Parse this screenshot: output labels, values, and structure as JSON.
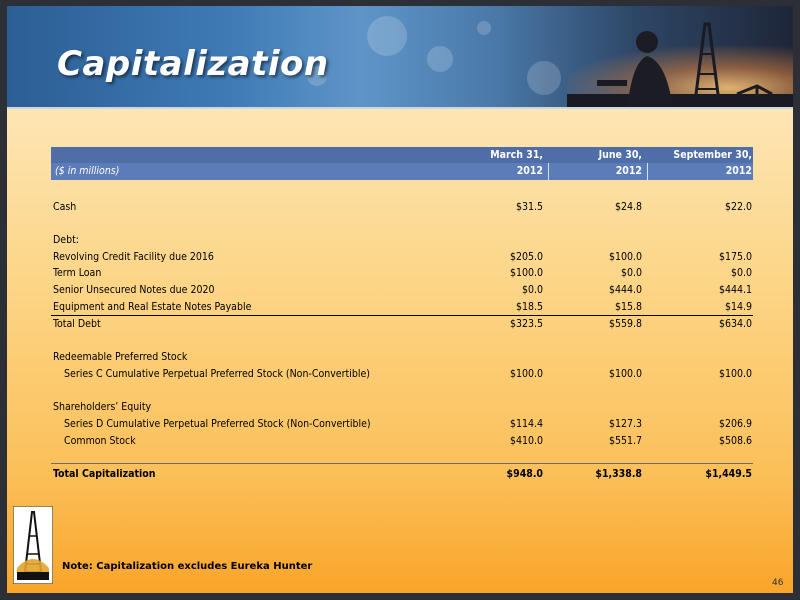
{
  "slide": {
    "title": "Capitalization",
    "note": "Note: Capitalization excludes Eureka Hunter",
    "page_number": "46"
  },
  "table": {
    "units_label": "($ in millions)",
    "columns": [
      {
        "line1": "March 31,",
        "line2": "2012"
      },
      {
        "line1": "June 30,",
        "line2": "2012"
      },
      {
        "line1": "September 30,",
        "line2": "2012"
      }
    ],
    "rows": [
      {
        "label": "Cash",
        "values": [
          "$31.5",
          "$24.8",
          "$22.0"
        ]
      },
      {
        "label": "Debt:",
        "values": [
          "",
          "",
          ""
        ]
      },
      {
        "label": "Revolving Credit Facility due 2016",
        "values": [
          "$205.0",
          "$100.0",
          "$175.0"
        ]
      },
      {
        "label": "Term Loan",
        "values": [
          "$100.0",
          "$0.0",
          "$0.0"
        ]
      },
      {
        "label": "Senior Unsecured Notes due 2020",
        "values": [
          "$0.0",
          "$444.0",
          "$444.1"
        ]
      },
      {
        "label": "Equipment and Real Estate Notes Payable",
        "values": [
          "$18.5",
          "$15.8",
          "$14.9"
        ]
      },
      {
        "label": "Total Debt",
        "values": [
          "$323.5",
          "$559.8",
          "$634.0"
        ]
      },
      {
        "label": "Redeemable Preferred Stock",
        "values": [
          "",
          "",
          ""
        ]
      },
      {
        "label": "Series C Cumulative Perpetual Preferred Stock (Non-Convertible)",
        "values": [
          "$100.0",
          "$100.0",
          "$100.0"
        ]
      },
      {
        "label": "Shareholders’ Equity",
        "values": [
          "",
          "",
          ""
        ]
      },
      {
        "label": "Series D Cumulative Perpetual Preferred Stock (Non-Convertible)",
        "values": [
          "$114.4",
          "$127.3",
          "$206.9"
        ]
      },
      {
        "label": "Common Stock",
        "values": [
          "$410.0",
          "$551.7",
          "$508.6"
        ]
      },
      {
        "label": "Total Capitalization",
        "values": [
          "$948.0",
          "$1,338.8",
          "$1,449.5"
        ]
      }
    ]
  },
  "colors": {
    "header_blue": "#4f6ea8",
    "panel_top": "#fde5b4",
    "panel_bottom": "#f9a52a"
  }
}
